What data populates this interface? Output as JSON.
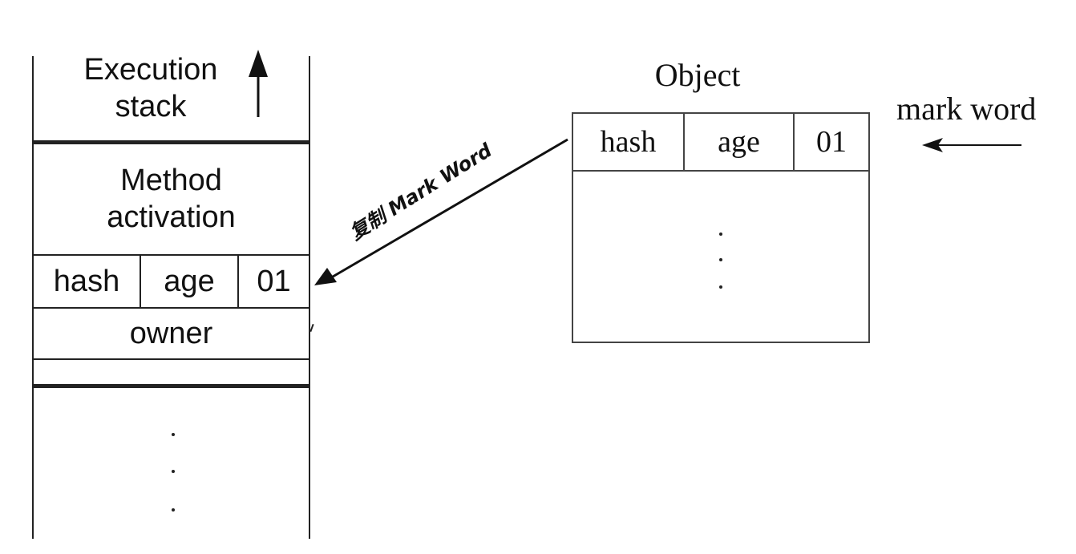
{
  "stack": {
    "execution_label": "Execution\nstack",
    "method_label": "Method\nactivation",
    "lock_record": {
      "hash": "hash",
      "age": "age",
      "bits": "01"
    },
    "owner": "owner",
    "ellipsis": "⋮"
  },
  "object": {
    "title": "Object",
    "mark_word": {
      "hash": "hash",
      "age": "age",
      "bits": "01"
    },
    "ellipsis": "⋮"
  },
  "labels": {
    "mark_word_label": "mark word",
    "copy_label": "复制 Mark Word"
  }
}
